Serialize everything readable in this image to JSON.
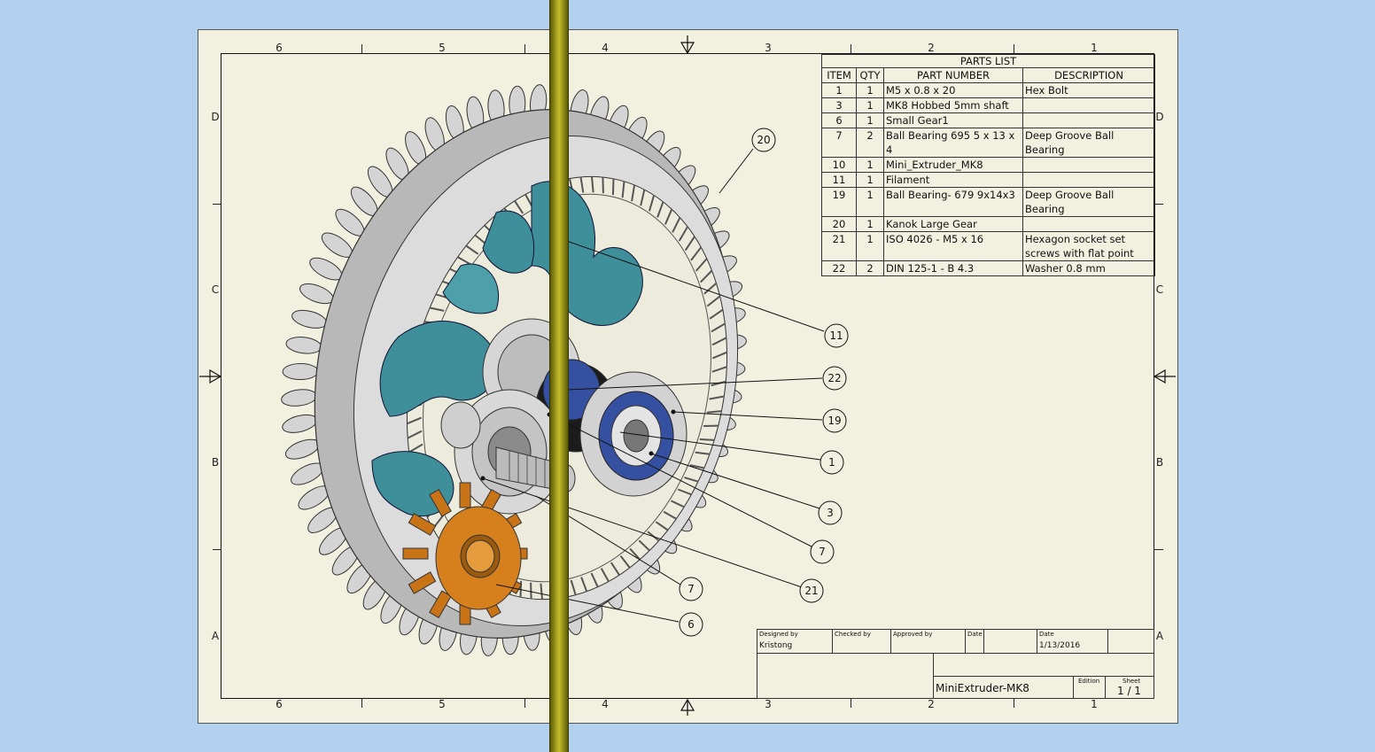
{
  "zones": {
    "columns": [
      "6",
      "5",
      "4",
      "3",
      "2",
      "1"
    ],
    "rows": [
      "D",
      "C",
      "B",
      "A"
    ]
  },
  "parts_list": {
    "title": "PARTS LIST",
    "headers": [
      "ITEM",
      "QTY",
      "PART NUMBER",
      "DESCRIPTION"
    ],
    "rows": [
      {
        "item": "1",
        "qty": "1",
        "part": "M5 x 0.8 x 20",
        "desc": "Hex Bolt"
      },
      {
        "item": "3",
        "qty": "1",
        "part": "MK8 Hobbed 5mm shaft",
        "desc": ""
      },
      {
        "item": "6",
        "qty": "1",
        "part": "Small Gear1",
        "desc": ""
      },
      {
        "item": "7",
        "qty": "2",
        "part": "Ball Bearing 695 5 x 13 x 4",
        "desc": "Deep Groove Ball Bearing"
      },
      {
        "item": "10",
        "qty": "1",
        "part": "Mini_Extruder_MK8",
        "desc": ""
      },
      {
        "item": "11",
        "qty": "1",
        "part": "Filament",
        "desc": ""
      },
      {
        "item": "19",
        "qty": "1",
        "part": "Ball Bearing- 679 9x14x3",
        "desc": "Deep Groove Ball Bearing"
      },
      {
        "item": "20",
        "qty": "1",
        "part": "Kanok Large Gear",
        "desc": ""
      },
      {
        "item": "21",
        "qty": "1",
        "part": "ISO 4026 - M5 x 16",
        "desc": "Hexagon socket set screws with flat point"
      },
      {
        "item": "22",
        "qty": "2",
        "part": "DIN 125-1 - B 4.3",
        "desc": "Washer 0.8 mm"
      }
    ]
  },
  "balloons": [
    "20",
    "11",
    "22",
    "19",
    "1",
    "3",
    "7",
    "7",
    "21",
    "6"
  ],
  "title_block": {
    "designed_by_label": "Designed by",
    "designed_by": "Kristong",
    "checked_by_label": "Checked by",
    "approved_by_label": "Approved by",
    "date_label_1": "Date",
    "date_label_2": "Date",
    "date": "1/13/2016",
    "drawing_name": "MiniExtruder-MK8",
    "edition_label": "Edition",
    "sheet_label": "Sheet",
    "sheet": "1 / 1"
  },
  "colors": {
    "background": "#b3d0ef",
    "sheet": "#f2f1e0",
    "gear_gray": "#c9c9c9",
    "teal_part": "#3f8f9a",
    "orange_gear": "#d5801c",
    "bearing_blue": "#3550a0",
    "ruler": "#9b9618"
  }
}
